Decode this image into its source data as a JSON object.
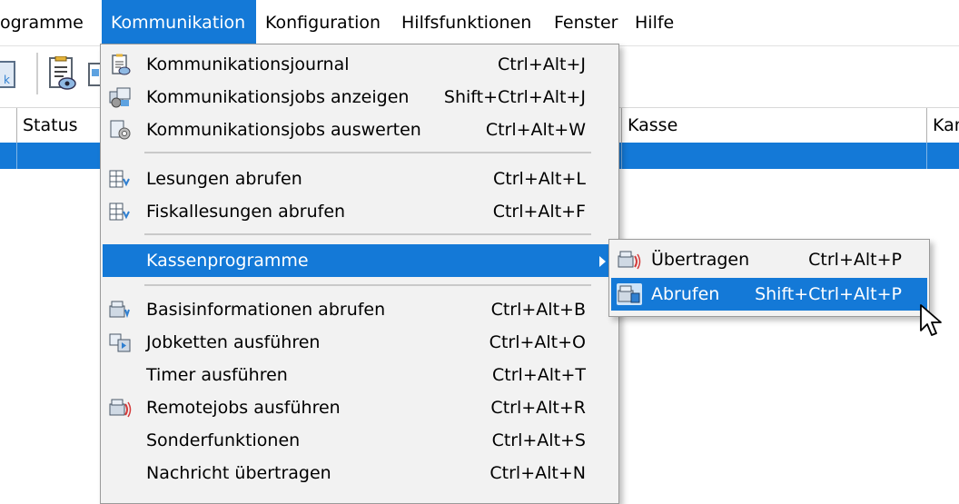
{
  "menubar": {
    "items": [
      {
        "label": "ogramme",
        "active": false
      },
      {
        "label": "Kommunikation",
        "active": true
      },
      {
        "label": "Konfiguration",
        "active": false
      },
      {
        "label": "Hilfsfunktionen",
        "active": false
      },
      {
        "label": "Fenster",
        "active": false
      },
      {
        "label": "Hilfe",
        "active": false
      }
    ]
  },
  "grid": {
    "columns": [
      "Status",
      "Kasse",
      "Kan"
    ]
  },
  "menu": {
    "items": [
      {
        "label": "Kommunikationsjournal",
        "shortcut": "Ctrl+Alt+J",
        "icon": "journal-icon"
      },
      {
        "label": "Kommunikationsjobs anzeigen",
        "shortcut": "Shift+Ctrl+Alt+J",
        "icon": "jobs-icon"
      },
      {
        "label": "Kommunikationsjobs auswerten",
        "shortcut": "Ctrl+Alt+W",
        "icon": "evaluate-icon"
      },
      {
        "label": "Lesungen abrufen",
        "shortcut": "Ctrl+Alt+L",
        "icon": "readings-icon"
      },
      {
        "label": "Fiskallesungen abrufen",
        "shortcut": "Ctrl+Alt+F",
        "icon": "fiscal-readings-icon"
      },
      {
        "label": "Kassenprogramme",
        "shortcut": "",
        "icon": ""
      },
      {
        "label": "Basisinformationen abrufen",
        "shortcut": "Ctrl+Alt+B",
        "icon": "basis-info-icon"
      },
      {
        "label": "Jobketten ausführen",
        "shortcut": "Ctrl+Alt+O",
        "icon": "job-chain-icon"
      },
      {
        "label": "Timer ausführen",
        "shortcut": "Ctrl+Alt+T",
        "icon": ""
      },
      {
        "label": "Remotejobs ausführen",
        "shortcut": "Ctrl+Alt+R",
        "icon": "remote-jobs-icon"
      },
      {
        "label": "Sonderfunktionen",
        "shortcut": "Ctrl+Alt+S",
        "icon": ""
      },
      {
        "label": "Nachricht übertragen",
        "shortcut": "Ctrl+Alt+N",
        "icon": ""
      }
    ]
  },
  "submenu": {
    "items": [
      {
        "label": "Übertragen",
        "shortcut": "Ctrl+Alt+P",
        "icon": "transfer-icon"
      },
      {
        "label": "Abrufen",
        "shortcut": "Shift+Ctrl+Alt+P",
        "icon": "retrieve-icon"
      }
    ]
  },
  "colors": {
    "highlight": "#1479d7",
    "menu_bg": "#f2f2f2"
  }
}
